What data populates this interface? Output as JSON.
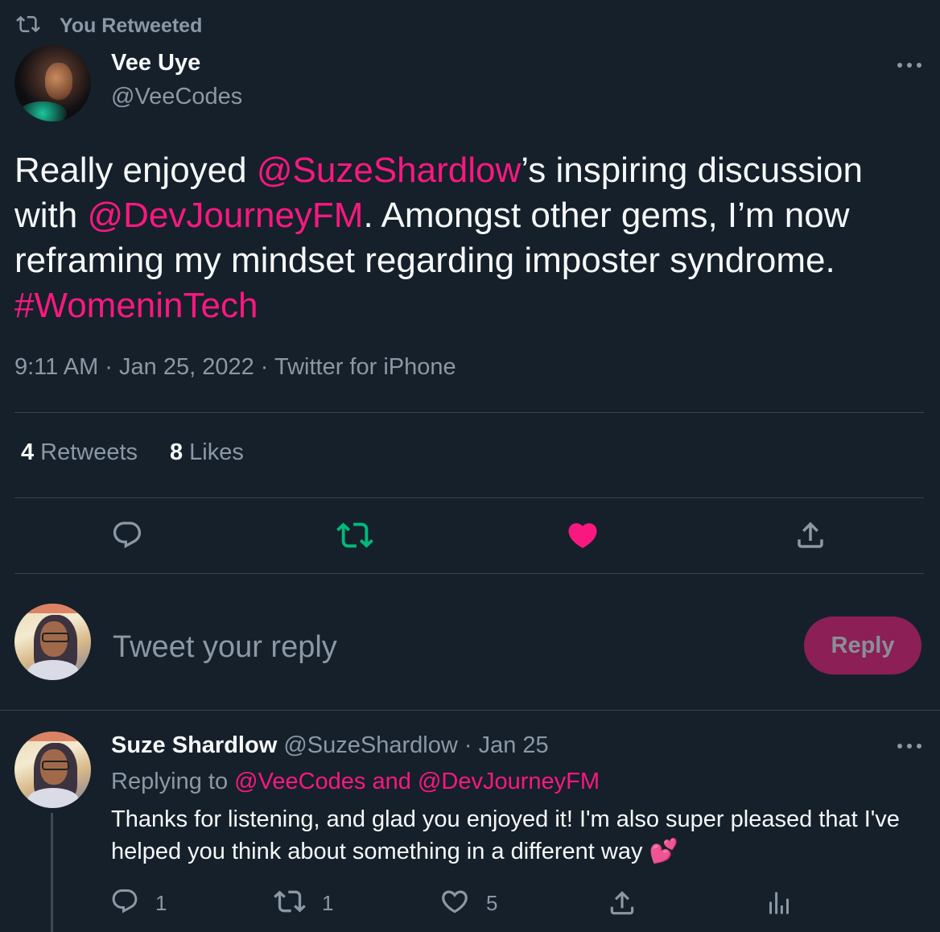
{
  "retweet_header": {
    "label": "You Retweeted",
    "icon": "retweet-icon"
  },
  "tweet": {
    "author_name": "Vee Uye",
    "author_handle": "@VeeCodes",
    "body": {
      "t1": "Really enjoyed ",
      "mention1": "@SuzeShardlow",
      "t2": "’s inspiring discussion with ",
      "mention2": "@DevJourneyFM",
      "t3": ". Amongst other gems, I’m now reframing my mindset regarding imposter syndrome. ",
      "hashtag": "#WomeninTech"
    },
    "meta": "9:11 AM · Jan 25, 2022 · Twitter for iPhone",
    "stats": {
      "retweets_count": "4",
      "retweets_label": "Retweets",
      "likes_count": "8",
      "likes_label": "Likes"
    },
    "actions": [
      "reply-icon",
      "retweet-icon",
      "heart-icon",
      "share-icon"
    ],
    "state": {
      "retweeted": true,
      "liked": true
    }
  },
  "composer": {
    "placeholder": "Tweet your reply",
    "reply_button": "Reply"
  },
  "reply": {
    "author_name": "Suze Shardlow",
    "author_handle": "@SuzeShardlow",
    "separator": " · ",
    "date": "Jan 25",
    "replying_prefix": "Replying to ",
    "replying_mention1": "@VeeCodes",
    "replying_and": " and ",
    "replying_mention2": "@DevJourneyFM",
    "text": "Thanks for listening, and glad you enjoyed it! I'm also super pleased that I've helped you think about something in a different way ",
    "emoji": "💕",
    "counts": {
      "replies": "1",
      "retweets": "1",
      "likes": "5"
    }
  },
  "colors": {
    "background": "#15202b",
    "accent": "#f91880",
    "retweet_green": "#00ba7c",
    "muted": "#8b98a5",
    "divider": "#38444d"
  }
}
